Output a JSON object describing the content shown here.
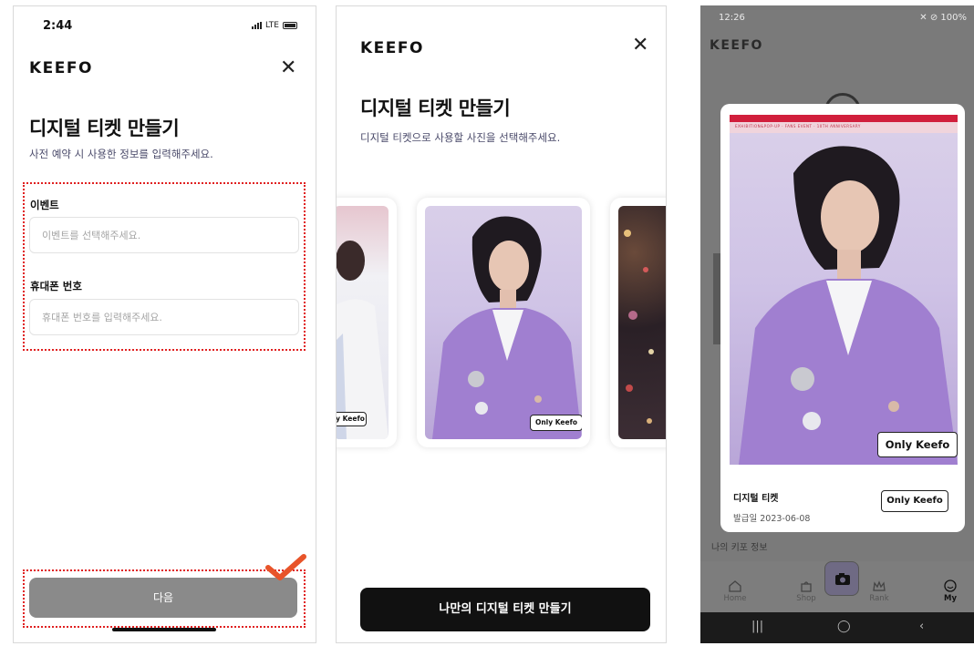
{
  "phone1": {
    "status_time": "2:44",
    "status_network": "LTE",
    "brand": "KEEFO",
    "title": "디지털 티켓 만들기",
    "subtitle": "사전 예약 시 사용한 정보를 입력해주세요.",
    "event_label": "이벤트",
    "event_placeholder": "이벤트를 선택해주세요.",
    "phone_label": "휴대폰 번호",
    "phone_placeholder": "휴대폰 번호를 입력해주세요.",
    "next_button": "다음"
  },
  "phone2": {
    "brand": "KEEFO",
    "title": "디지털 티켓 만들기",
    "subtitle": "디지털 티켓으로 사용할 사진을 선택해주세요.",
    "left_badge": "y Keefo",
    "badge": "Only Keefo",
    "cta_button": "나만의 디지털 티켓 만들기"
  },
  "phone3": {
    "status_time": "12:26",
    "status_right": "100%",
    "brand": "KEEFO",
    "ticket_strip_text": "EXHIBITION&POP-UP  ·  FANS EVENT  ·  10TH ANNIVERSARY",
    "photo_badge": "Only Keefo",
    "ticket_name": "디지털 티켓",
    "ticket_date": "발급일 2023-06-08",
    "ticket_badge": "Only Keefo",
    "partial_menu": "나의 키포 정보",
    "nav": {
      "home": "Home",
      "shop": "Shop",
      "rank": "Rank",
      "my": "My"
    }
  },
  "colors": {
    "accent": "#7b4cf2",
    "highlight_border": "#e02020",
    "next_button_bg": "#8a8a8a",
    "cta_bg": "#111111",
    "checkmark": "#e8542a"
  }
}
